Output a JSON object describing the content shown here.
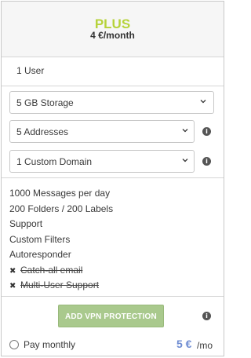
{
  "plan": {
    "name": "PLUS",
    "price": "4 €/month",
    "name_color": "#b6d33a"
  },
  "users": "1 User",
  "selects": {
    "storage": "5 GB Storage",
    "addresses": "5 Addresses",
    "domain": "1 Custom Domain"
  },
  "info_icon_glyph": "i",
  "features": [
    {
      "label": "1000 Messages per day",
      "enabled": true
    },
    {
      "label": "200 Folders / 200 Labels",
      "enabled": true
    },
    {
      "label": "Support",
      "enabled": true
    },
    {
      "label": "Custom Filters",
      "enabled": true
    },
    {
      "label": "Autoresponder",
      "enabled": true
    },
    {
      "label": "Catch-all email",
      "enabled": false
    },
    {
      "label": "Multi-User Support",
      "enabled": false
    }
  ],
  "disabled_mark": "✖",
  "vpn_button": "ADD VPN PROTECTION",
  "footer": {
    "pay_monthly": "Pay monthly",
    "amount": "5 €",
    "unit": "/mo"
  },
  "colors": {
    "accent_price": "#6e8cd2",
    "vpn_button_bg": "#a9c98d"
  }
}
